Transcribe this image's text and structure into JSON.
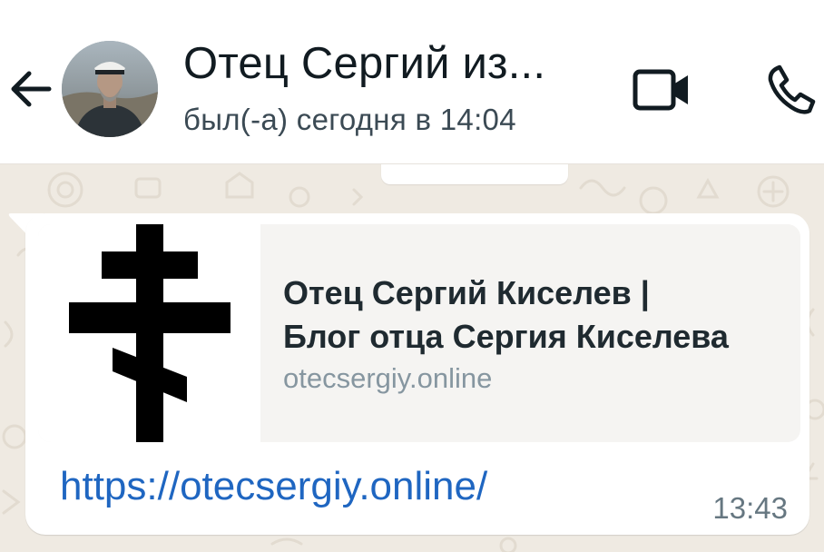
{
  "header": {
    "contact_name": "Отец Сергий из...",
    "status": "был(-а) сегодня в 14:04",
    "icons": {
      "back": "arrow-left-icon",
      "video": "video-camera-icon",
      "call": "phone-icon"
    }
  },
  "message": {
    "preview": {
      "title_line1": "Отец Сергий Киселев |",
      "title_line2": "Блог отца Сергия Киселева",
      "domain": "otecsergiy.online",
      "thumbnail_icon": "orthodox-cross-icon"
    },
    "link_text": "https://otecsergiy.online/",
    "time": "13:43"
  },
  "colors": {
    "header_bg": "#ffffff",
    "chat_bg": "#efeae2",
    "bubble_bg": "#ffffff",
    "preview_bg": "#f5f4f2",
    "link": "#1f66c1",
    "text_primary": "#111b21",
    "text_secondary": "#667781"
  }
}
